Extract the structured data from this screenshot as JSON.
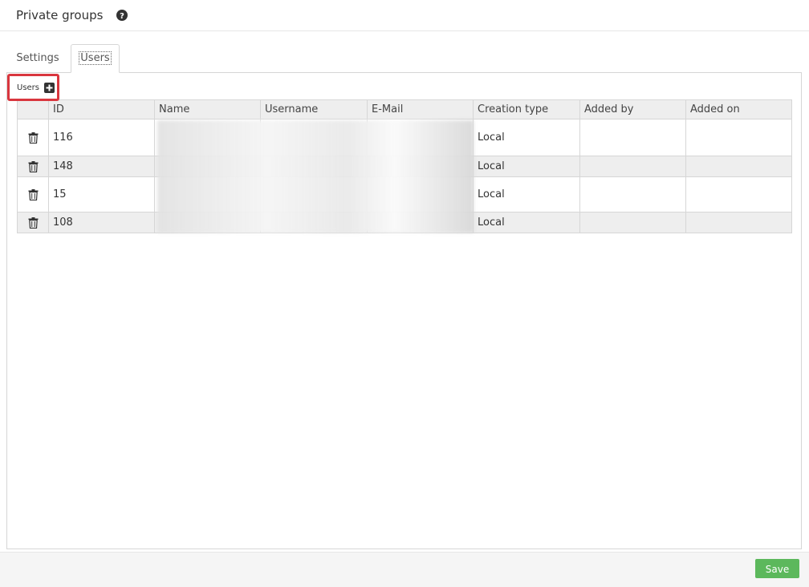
{
  "header": {
    "title": "Private groups",
    "help_icon": "question-circle-icon"
  },
  "tabs": [
    {
      "label": "Settings",
      "active": false
    },
    {
      "label": "Users",
      "active": true
    }
  ],
  "users_section": {
    "label": "Users",
    "add_icon": "plus-square-icon"
  },
  "table": {
    "columns": [
      "ID",
      "Name",
      "Username",
      "E-Mail",
      "Creation type",
      "Added by",
      "Added on"
    ],
    "rows": [
      {
        "id": "116",
        "name": "",
        "username": "",
        "email": "",
        "creation_type": "Local",
        "added_by": "",
        "added_on": ""
      },
      {
        "id": "148",
        "name": "",
        "username": "",
        "email": "",
        "creation_type": "Local",
        "added_by": "",
        "added_on": ""
      },
      {
        "id": "15",
        "name": "",
        "username": "",
        "email": "",
        "creation_type": "Local",
        "added_by": "",
        "added_on": ""
      },
      {
        "id": "108",
        "name": "",
        "username": "",
        "email": "",
        "creation_type": "Local",
        "added_by": "",
        "added_on": ""
      }
    ],
    "row_action_icon": "trash-icon"
  },
  "footer": {
    "save_label": "Save"
  },
  "colors": {
    "save_button": "#5cb85c",
    "highlight_border": "#d9363e",
    "alt_row": "#eeeeee"
  }
}
